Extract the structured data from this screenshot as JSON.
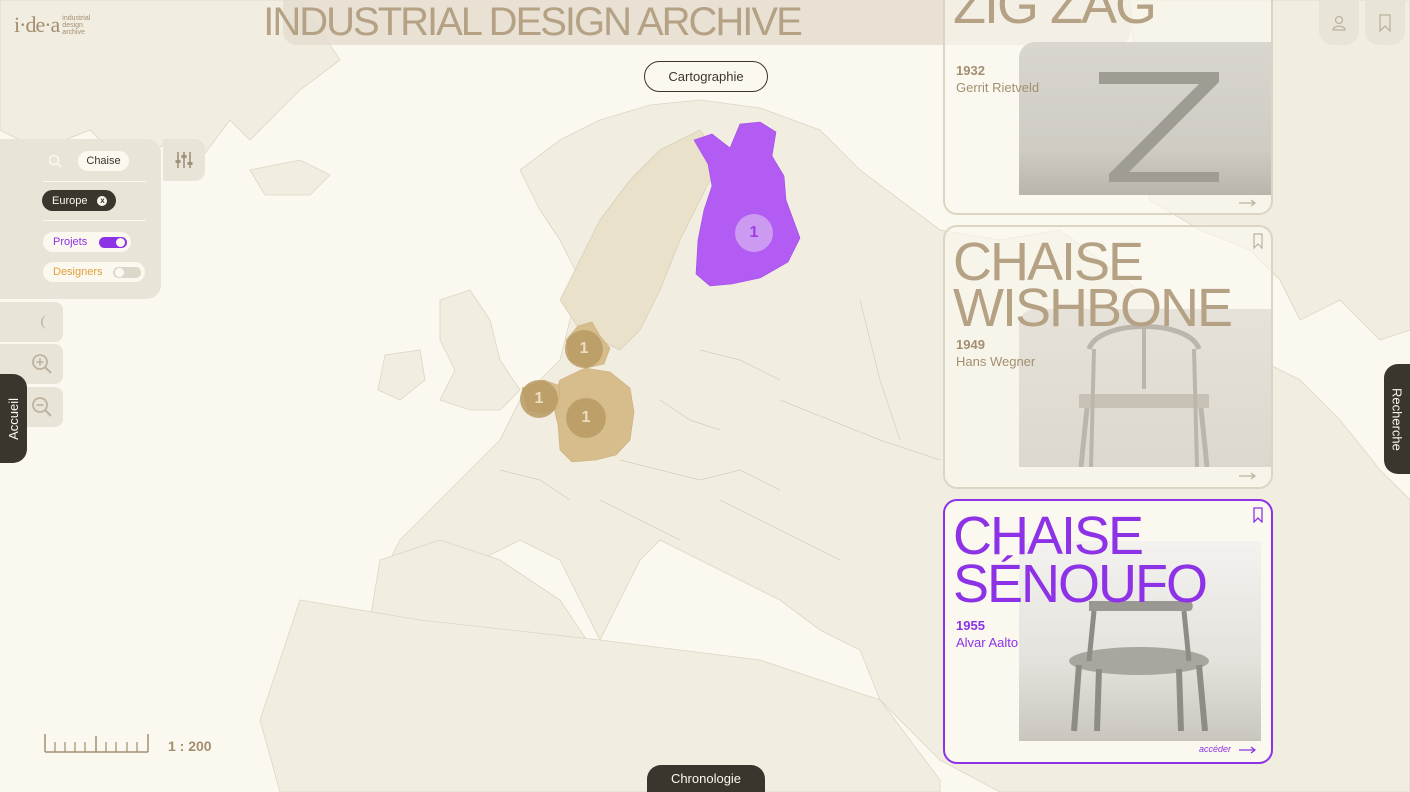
{
  "header": {
    "logo_mark": "i·de·a",
    "logo_text": "industrial design archive",
    "title": "INDUSTRIAL DESIGN ARCHIVE",
    "view_button": "Cartographie",
    "icons": [
      "user-icon",
      "bookmark-icon"
    ]
  },
  "filters": {
    "search_query": "Chaise",
    "region": "Europe",
    "region_clear": "x",
    "toggles": [
      {
        "label": "Projets",
        "on": true,
        "color": "#8d32e6"
      },
      {
        "label": "Designers",
        "on": false,
        "color": "#e0a03c"
      }
    ],
    "icons": [
      "search-icon",
      "sliders-icon",
      "moon-icon",
      "zoom-in-icon",
      "zoom-out-icon"
    ]
  },
  "nav": {
    "left_tab": "Accueil",
    "right_tab": "Recherche",
    "bottom_tab": "Chronologie"
  },
  "map": {
    "clusters": [
      {
        "label": "1",
        "country": "Finland",
        "color": "purple"
      },
      {
        "label": "1",
        "country": "Denmark",
        "color": "beige"
      },
      {
        "label": "1",
        "country": "Netherlands",
        "color": "beige"
      },
      {
        "label": "1",
        "country": "Germany",
        "color": "beige"
      }
    ],
    "scale_label": "1 : 200"
  },
  "cards": [
    {
      "title": "ZIG ZAG",
      "year": "1932",
      "designer": "Gerrit Rietveld",
      "active": false
    },
    {
      "title_line1": "CHAISE",
      "title_line2": "WISHBONE",
      "year": "1949",
      "designer": "Hans Wegner",
      "active": false
    },
    {
      "title_line1": "CHAISE",
      "title_line2": "SÉNOUFO",
      "year": "1955",
      "designer": "Alvar Aalto",
      "active": true,
      "link": "accéder"
    }
  ],
  "colors": {
    "background": "#fbf8ef",
    "accent_purple": "#8d32e6",
    "beige": "#d8bd8c",
    "dark": "#3a352d"
  }
}
